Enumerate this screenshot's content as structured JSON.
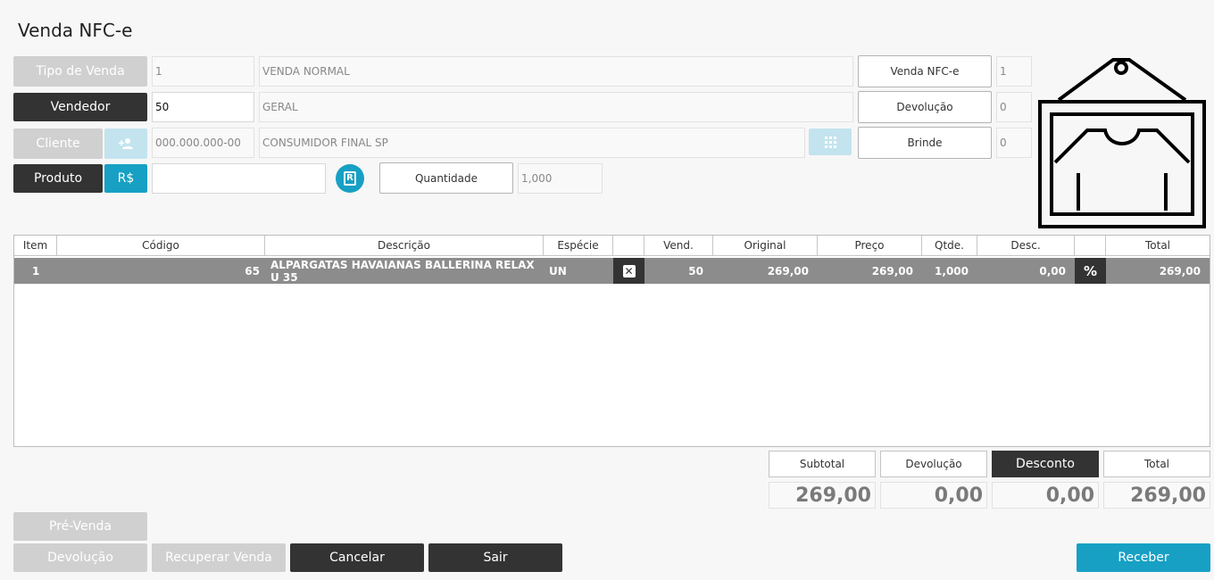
{
  "window": {
    "title": "Venda NFC-e"
  },
  "form": {
    "tipo_venda": {
      "button": "Tipo de Venda",
      "code": "1",
      "desc": "VENDA NORMAL"
    },
    "vendedor": {
      "button": "Vendedor",
      "code": "50",
      "desc": "GERAL"
    },
    "cliente": {
      "button": "Cliente",
      "doc": "000.000.000-00",
      "desc": "CONSUMIDOR FINAL SP"
    },
    "produto": {
      "button": "Produto",
      "price_button": "R$",
      "search_value": "",
      "quantidade_label": "Quantidade",
      "quantidade_value": "1,000"
    }
  },
  "counters": [
    {
      "label": "Venda NFC-e",
      "value": "1"
    },
    {
      "label": "Devolução",
      "value": "0"
    },
    {
      "label": "Brinde",
      "value": "0"
    }
  ],
  "table": {
    "columns": [
      "Item",
      "Código",
      "Descrição",
      "Espécie",
      "",
      "Vend.",
      "Original",
      "Preço",
      "Qtde.",
      "Desc.",
      "",
      "Total"
    ],
    "rows": [
      {
        "item": "1",
        "codigo": "65",
        "descricao": "ALPARGATAS HAVAIANAS BALLERINA RELAX U 35",
        "especie": "UN",
        "vend": "50",
        "original": "269,00",
        "preco": "269,00",
        "qtde": "1,000",
        "desc": "0,00",
        "total": "269,00"
      }
    ]
  },
  "totals": {
    "subtotal_label": "Subtotal",
    "subtotal": "269,00",
    "devolucao_label": "Devolução",
    "devolucao": "0,00",
    "desconto_label": "Desconto",
    "desconto": "0,00",
    "total_label": "Total",
    "total": "269,00"
  },
  "footer": {
    "pre_venda": "Pré-Venda",
    "devolucao": "Devolução",
    "recuperar": "Recuperar Venda",
    "cancelar": "Cancelar",
    "sair": "Sair",
    "receber": "Receber"
  },
  "colors": {
    "accent": "#17a0c4",
    "dark": "#333333",
    "row_selected": "#8c8c8c",
    "disabled": "#d0d0d0"
  },
  "icons": [
    "add-person-icon",
    "keypad-icon",
    "r-badge-icon",
    "delete-x-icon",
    "percent-icon",
    "shirt-tag-logo"
  ]
}
